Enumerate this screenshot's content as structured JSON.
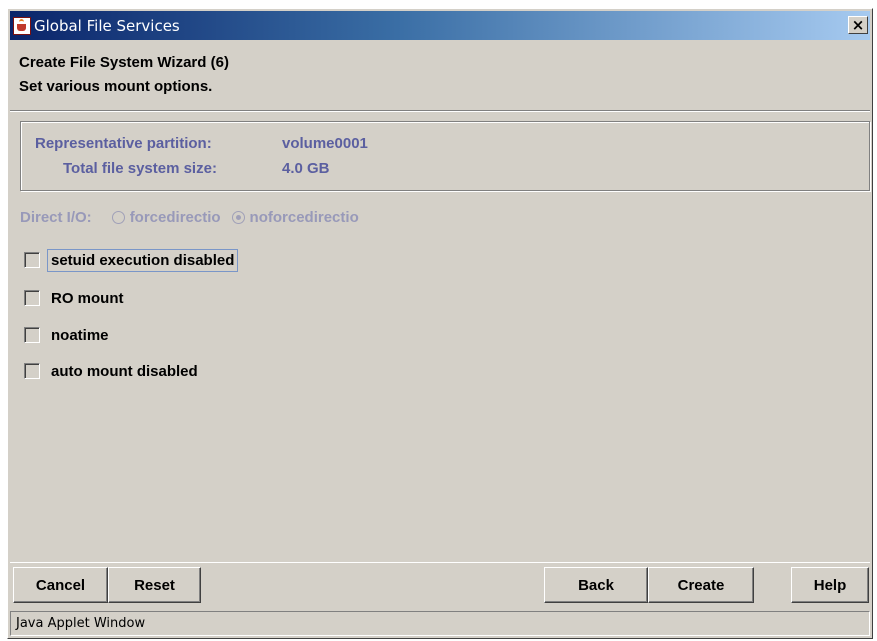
{
  "window": {
    "title": "Global File Services",
    "close_glyph": "×",
    "icon": "java-applet-icon"
  },
  "wizard": {
    "title": "Create File System Wizard (6)",
    "subtitle": "Set various mount options."
  },
  "info": {
    "partition_label": "Representative partition:",
    "partition_value": "volume0001",
    "size_label": "Total file system size:",
    "size_value": "4.0 GB",
    "text_color": "#5b5fa0"
  },
  "direct_io": {
    "label": "Direct I/O:",
    "enabled": false,
    "options": [
      {
        "label": "forcedirectio",
        "selected": false
      },
      {
        "label": "noforcedirectio",
        "selected": true
      }
    ],
    "display_labels": [
      "forcedirectio",
      "noforcedirectio"
    ]
  },
  "options": [
    {
      "label": "setuid execution disabled",
      "checked": false,
      "focused": true
    },
    {
      "label": "RO mount",
      "checked": false,
      "focused": false
    },
    {
      "label": "noatime",
      "checked": false,
      "focused": false
    },
    {
      "label": "auto mount disabled",
      "checked": false,
      "focused": false
    }
  ],
  "buttons": {
    "cancel": "Cancel",
    "reset": "Reset",
    "back": "Back",
    "create": "Create",
    "help": "Help"
  },
  "status_bar": {
    "text": "Java Applet Window"
  },
  "colors": {
    "window_bg": "#d4d0c8",
    "title_bar_start": "#0a246a",
    "title_bar_end": "#a6caf0",
    "disabled_text": "#9899b9"
  }
}
